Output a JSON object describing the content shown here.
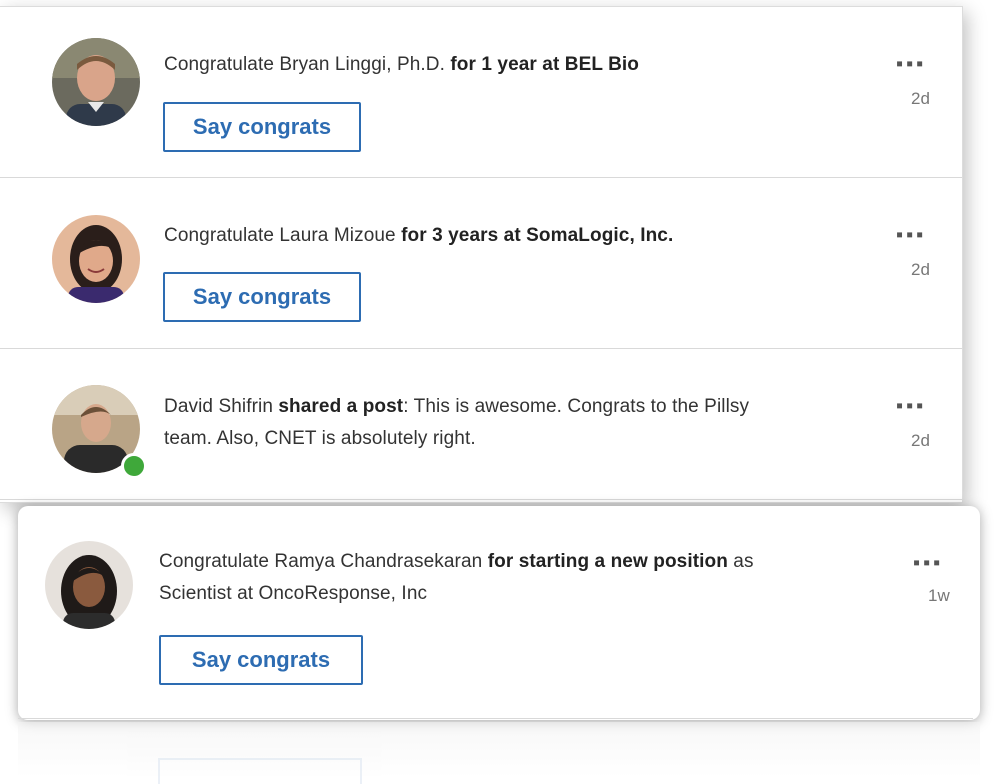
{
  "feed": {
    "items": [
      {
        "pre": "Congratulate Bryan Linggi, Ph.D. ",
        "bold": "for 1 year at BEL Bio",
        "post": "",
        "button": "Say congrats",
        "time": "2d",
        "more": "▪▪▪"
      },
      {
        "pre": "Congratulate Laura Mizoue ",
        "bold": "for 3 years at SomaLogic, Inc.",
        "post": "",
        "button": "Say congrats",
        "time": "2d",
        "more": "▪▪▪"
      },
      {
        "pre": "David Shifrin ",
        "bold": "shared a post",
        "post": ": This is awesome. Congrats to the Pillsy",
        "line2": "team. Also, CNET is absolutely right.",
        "time": "2d",
        "more": "▪▪▪",
        "online": true
      },
      {
        "pre": "Congratulate Ramya Chandrasekaran ",
        "bold": "for starting a new position",
        "post": " as",
        "line2": "Scientist at OncoResponse, Inc",
        "button": "Say congrats",
        "time": "1w",
        "more": "▪▪▪"
      }
    ]
  },
  "icons": {
    "more": "more-options-icon",
    "online": "online-status-icon"
  },
  "colors": {
    "accent": "#2d6cb2",
    "online": "#3fa83a"
  }
}
